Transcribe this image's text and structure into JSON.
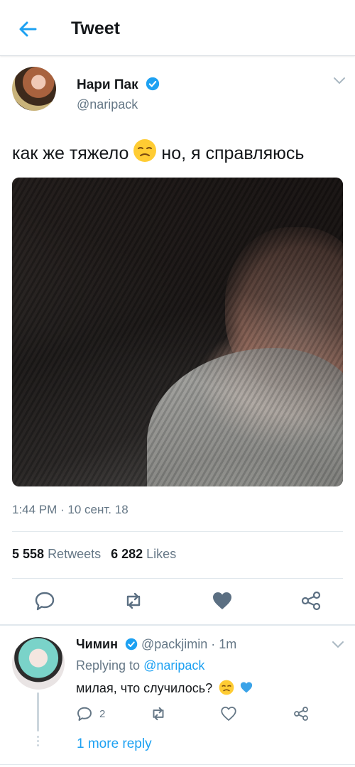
{
  "header": {
    "title": "Tweet"
  },
  "tweet": {
    "author_name": "Нари Пак",
    "author_handle": "@naripack",
    "text_before_emoji": "как же тяжело",
    "text_after_emoji": "но, я справляюсь",
    "timestamp": "1:44 PM · 10 сент. 18",
    "retweets_count": "5 558",
    "retweets_label": "Retweets",
    "likes_count": "6 282",
    "likes_label": "Likes"
  },
  "reply": {
    "author_name": "Чимин",
    "handle_time": "@packjimin · 1m",
    "replying_prefix": "Replying to",
    "replying_handle": "@naripack",
    "text": "милая, что случилось?",
    "reply_count": "2"
  },
  "more_replies": "1 more reply",
  "colors": {
    "accent": "#1da1f2",
    "text": "#14171a",
    "muted": "#657786",
    "divider": "#e1e8ed",
    "liked_heart": "#5b6f82"
  },
  "icons": [
    "back-arrow-icon",
    "verified-badge-icon",
    "chevron-down-icon",
    "sad-face-emoji",
    "reply-icon",
    "retweet-icon",
    "like-icon",
    "share-icon",
    "blue-heart-emoji"
  ]
}
